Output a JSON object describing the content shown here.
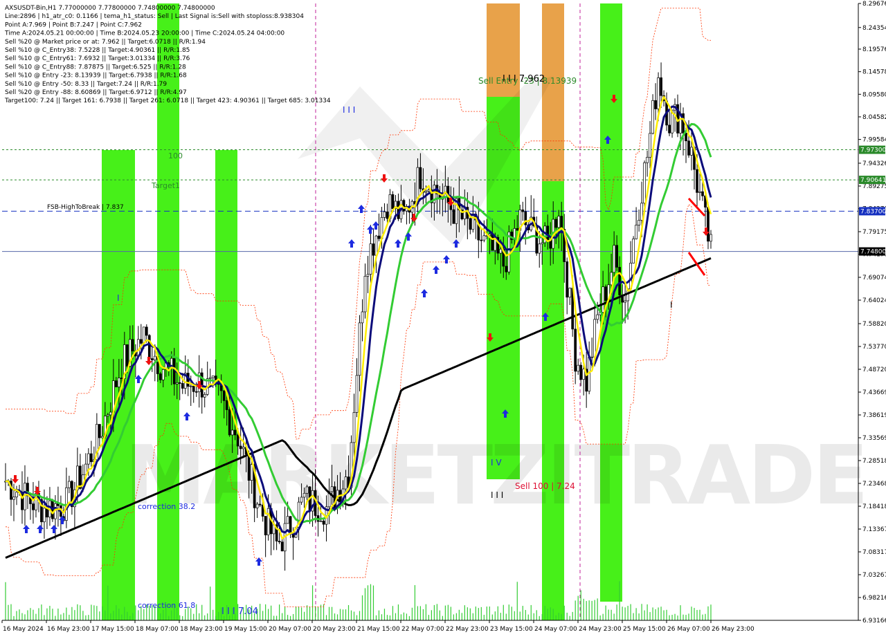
{
  "window": {
    "title": "AXSUSDT-Bin,H1  7.77000000 7.77800000 7.74800000 7.74800000"
  },
  "info_lines": [
    "AXSUSDT-Bin,H1  7.77000000 7.77800000 7.74800000 7.74800000",
    "Line:2896 | h1_atr_c0: 0.1166 | tema_h1_status: Sell | Last Signal is:Sell with stoploss:8.938304",
    "Point A:7.969 | Point B:7.247 | Point C:7.962",
    "Time A:2024.05.21 00:00:00 | Time B:2024.05.23 20:00:00 | Time C:2024.05.24 04:00:00",
    "Sell %20 @ Market price or at: 7.962 || Target:6.0718 || R/R:1.94",
    "Sell %10 @ C_Entry38: 7.5228 || Target:4.90361 || R/R:1.85",
    "Sell %10 @ C_Entry61: 7.6932 || Target:3.01334 || R/R:3.76",
    "Sell %10 @ C_Entry88: 7.87875 || Target:6.525 || R/R:1.28",
    "Sell %10 @ Entry -23: 8.13939 || Target:6.7938 || R/R:1.68",
    "Sell %10 @ Entry -50: 8.33 || Target:7.24 || R/R:1.79",
    "Sell %20 @ Entry -88: 8.60869 || Target:6.9712 || R/R:4.97",
    "Target100: 7.24 || Target 161: 6.7938 || Target 261: 6.0718 || Target 423: 4.90361 || Target 685: 3.01334"
  ],
  "annotations": {
    "fsb": "FSB-HighToBreak | 7.837",
    "label_100": "100",
    "target1": "Target1",
    "sell_entry": "Sell Entry -23 | 8.13939",
    "point_c": "I I I 7.962",
    "roman_a": "I I I",
    "roman_i": "I",
    "roman_iv": "I V",
    "roman_iii_b": "I I I",
    "roman_i2": "I",
    "sell_100": "Sell 100 | 7.24",
    "correction_382": "correction 38.2",
    "correction_618": "correction 61.8",
    "low_704": "I I I 7.04",
    "watermark": "MARKETZITRADE"
  },
  "colors": {
    "green_zone": "#33ee00",
    "orange_zone": "#e8a24a",
    "current_price_tag": "#000000",
    "level_tag": "#2a8a2a",
    "fsb_tag": "#1530c0",
    "ema_black": "#000000",
    "ma_navy": "#0b0b7a",
    "ma_yellow": "#ffee00",
    "ma_green": "#33cc33",
    "bands_red": "#ff3300"
  },
  "chart_data": {
    "type": "candlestick",
    "symbol": "AXSUSDT-Bin",
    "timeframe": "H1",
    "ylim": [
      6.93166,
      8.29676
    ],
    "y_ticks": [
      "8.29676",
      "8.24354",
      "8.19576",
      "8.14578",
      "8.09580",
      "8.04582",
      "7.99584",
      "7.94326",
      "7.89275",
      "7.84270",
      "7.79175",
      "7.74177",
      "7.69074",
      "7.64024",
      "7.58820",
      "7.53770",
      "7.48720",
      "7.43669",
      "7.38619",
      "7.33569",
      "7.28518",
      "7.23468",
      "7.18418",
      "7.13367",
      "7.08317",
      "7.03267",
      "6.98216",
      "6.93166"
    ],
    "x_ticks": [
      "16 May 2024",
      "16 May 23:00",
      "17 May 15:00",
      "18 May 07:00",
      "18 May 23:00",
      "19 May 15:00",
      "20 May 07:00",
      "20 May 23:00",
      "21 May 15:00",
      "22 May 07:00",
      "22 May 23:00",
      "23 May 15:00",
      "24 May 07:00",
      "24 May 23:00",
      "25 May 15:00",
      "26 May 07:00",
      "26 May 23:00"
    ],
    "levels": [
      {
        "name": "FSB-HighToBreak",
        "value": 7.837,
        "tag": "7.83700"
      },
      {
        "name": "level_97300",
        "value": 7.973,
        "tag": "7.97300"
      },
      {
        "name": "level_90641",
        "value": 7.90641,
        "tag": "7.90641"
      },
      {
        "name": "current_price",
        "value": 7.748,
        "tag": "7.74800"
      }
    ],
    "last_price": 7.748
  }
}
